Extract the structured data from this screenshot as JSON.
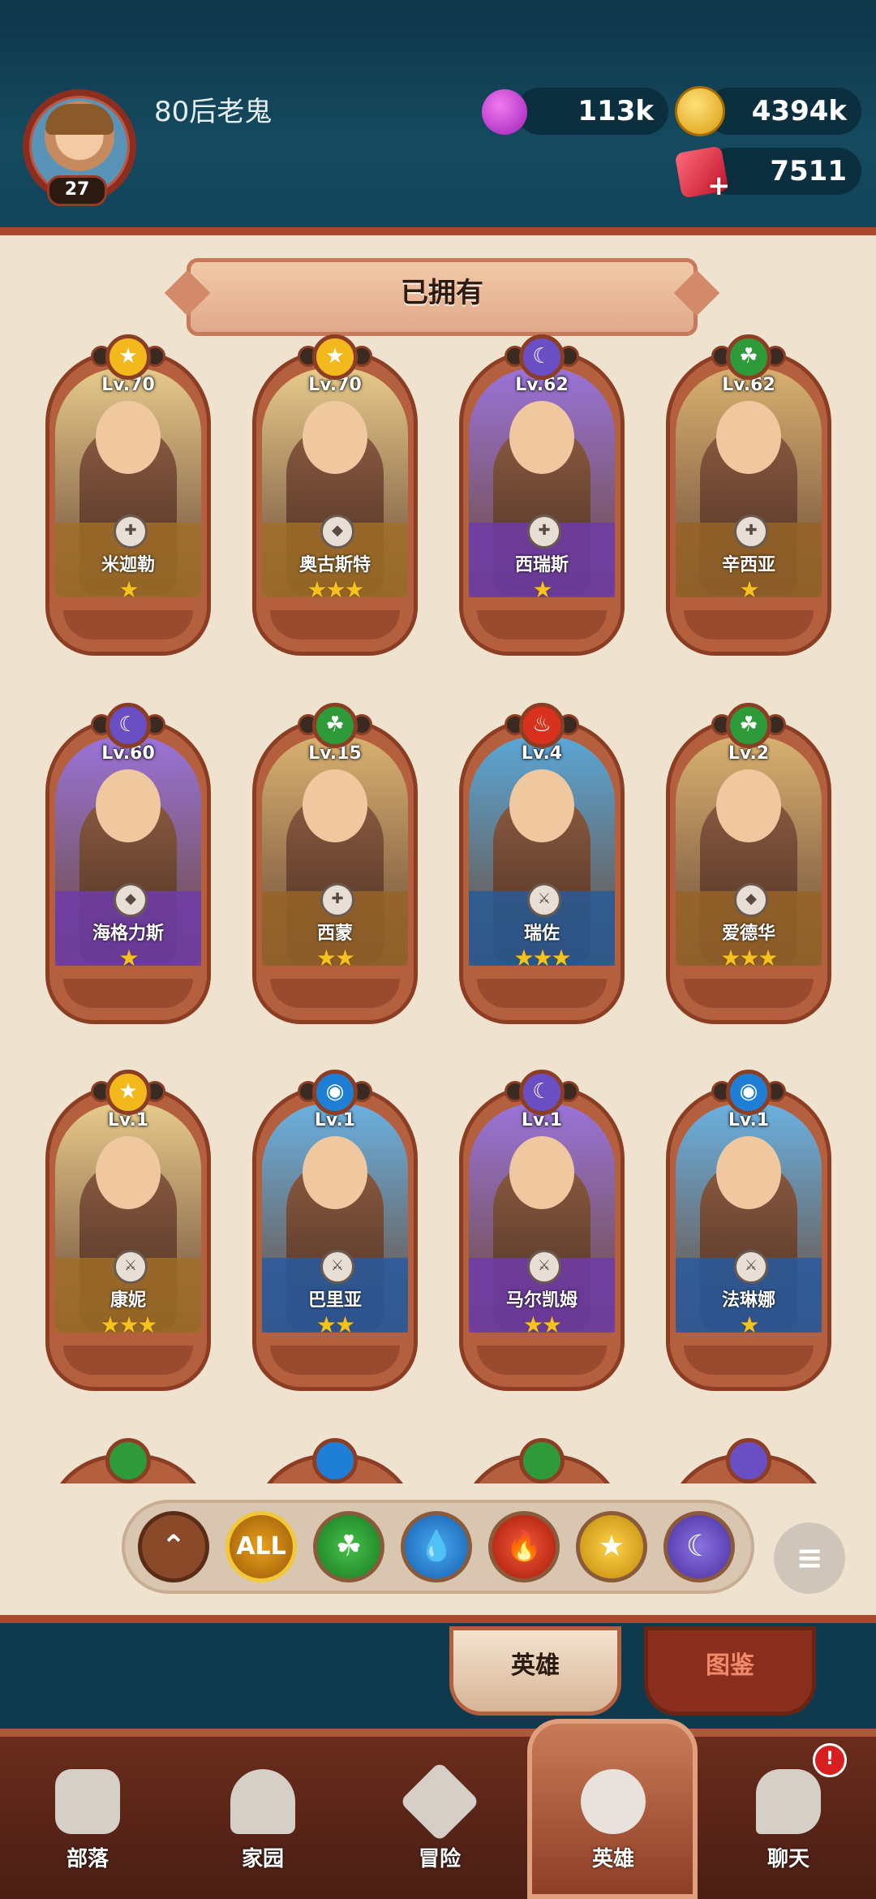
{
  "player": {
    "name": "80后老鬼",
    "level": "27"
  },
  "resources": {
    "elixir": "113k",
    "gold": "4394k",
    "gems": "7511"
  },
  "section_title": "已拥有",
  "heroes": [
    {
      "level": "Lv.70",
      "name": "米迦勒",
      "stars": "★",
      "element": "light",
      "role": "heal"
    },
    {
      "level": "Lv.70",
      "name": "奥古斯特",
      "stars": "★★★",
      "element": "light",
      "role": "tank"
    },
    {
      "level": "Lv.62",
      "name": "西瑞斯",
      "stars": "★",
      "element": "dark",
      "role": "heal"
    },
    {
      "level": "Lv.62",
      "name": "辛西亚",
      "stars": "★",
      "element": "nature",
      "role": "heal"
    },
    {
      "level": "Lv.60",
      "name": "海格力斯",
      "stars": "★",
      "element": "dark",
      "role": "tank"
    },
    {
      "level": "Lv.15",
      "name": "西蒙",
      "stars": "★★",
      "element": "nature",
      "role": "heal"
    },
    {
      "level": "Lv.4",
      "name": "瑞佐",
      "stars": "★★★",
      "element": "fire",
      "role": "melee"
    },
    {
      "level": "Lv.2",
      "name": "爱德华",
      "stars": "★★★",
      "element": "nature",
      "role": "tank"
    },
    {
      "level": "Lv.1",
      "name": "康妮",
      "stars": "★★★",
      "element": "light",
      "role": "melee"
    },
    {
      "level": "Lv.1",
      "name": "巴里亚",
      "stars": "★★",
      "element": "water",
      "role": "melee"
    },
    {
      "level": "Lv.1",
      "name": "马尔凯姆",
      "stars": "★★",
      "element": "dark",
      "role": "melee"
    },
    {
      "level": "Lv.1",
      "name": "法琳娜",
      "stars": "★",
      "element": "water",
      "role": "melee"
    }
  ],
  "filters": {
    "all_label": "ALL"
  },
  "tabs": {
    "heroes": "英雄",
    "codex": "图鉴"
  },
  "nav": {
    "tribe": "部落",
    "home": "家园",
    "adventure": "冒险",
    "heroes": "英雄",
    "chat": "聊天"
  },
  "alert_badge": "!",
  "colors": {
    "light": "#f2b81c",
    "dark": "#6a4fc4",
    "nature": "#2f9a3a",
    "fire": "#d8321e",
    "water": "#1f7fd6"
  }
}
